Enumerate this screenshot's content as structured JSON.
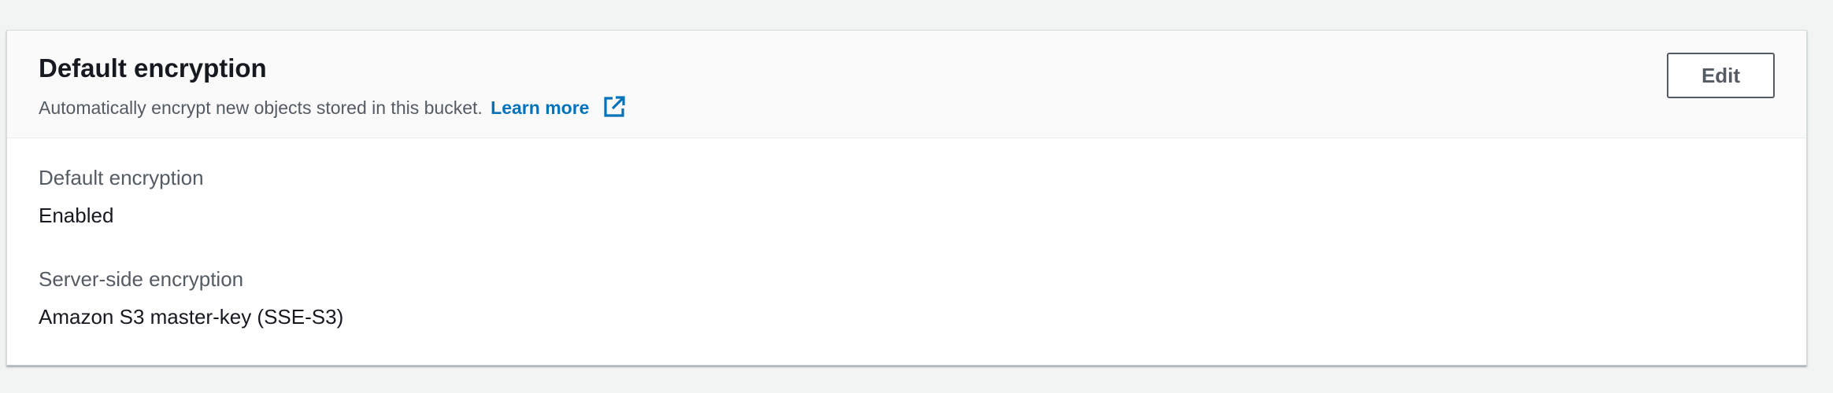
{
  "panel": {
    "title": "Default encryption",
    "description": "Automatically encrypt new objects stored in this bucket.",
    "learn_more_label": "Learn more",
    "edit_label": "Edit",
    "icons": {
      "external_link": "external-link-icon"
    },
    "colors": {
      "link": "#0073bb",
      "label": "#545b64",
      "text": "#16191f"
    }
  },
  "fields": [
    {
      "label": "Default encryption",
      "value": "Enabled"
    },
    {
      "label": "Server-side encryption",
      "value": "Amazon S3 master-key (SSE-S3)"
    }
  ]
}
